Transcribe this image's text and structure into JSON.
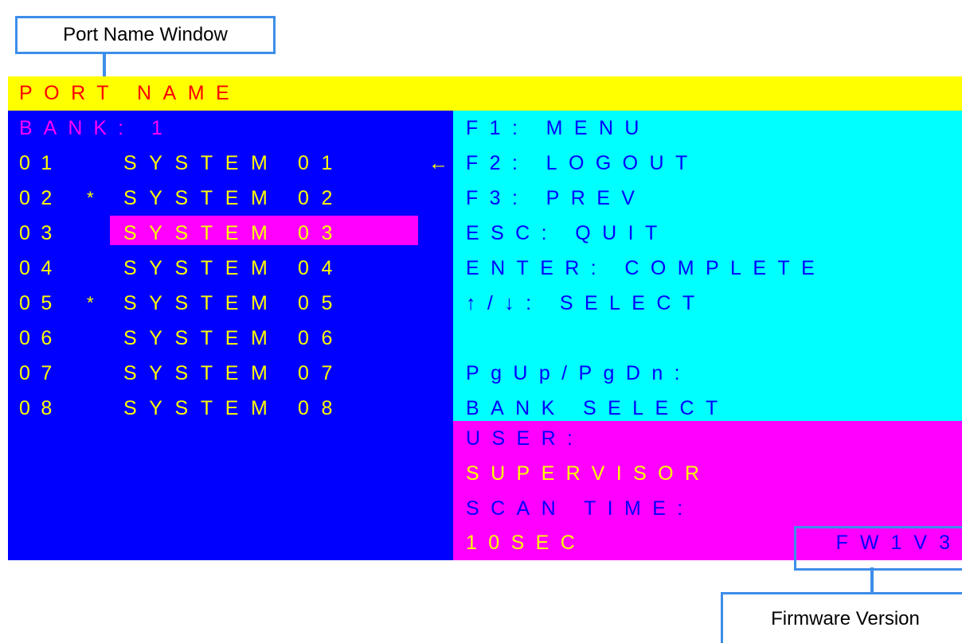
{
  "callouts": {
    "port_name_window": "Port Name Window",
    "firmware_version": "Firmware Version"
  },
  "osd": {
    "title": "PORT NAME",
    "bank_label": "BANK: 1",
    "ports": [
      {
        "number": "01",
        "star": "",
        "name": "SYSTEM 01",
        "selected": false,
        "arrow": "←"
      },
      {
        "number": "02",
        "star": "*",
        "name": "SYSTEM 02",
        "selected": false,
        "arrow": ""
      },
      {
        "number": "03",
        "star": "",
        "name": "SYSTEM 03",
        "selected": true,
        "arrow": ""
      },
      {
        "number": "04",
        "star": "",
        "name": "SYSTEM 04",
        "selected": false,
        "arrow": ""
      },
      {
        "number": "05",
        "star": "*",
        "name": "SYSTEM 05",
        "selected": false,
        "arrow": ""
      },
      {
        "number": "06",
        "star": "",
        "name": "SYSTEM 06",
        "selected": false,
        "arrow": ""
      },
      {
        "number": "07",
        "star": "",
        "name": "SYSTEM 07",
        "selected": false,
        "arrow": ""
      },
      {
        "number": "08",
        "star": "",
        "name": "SYSTEM 08",
        "selected": false,
        "arrow": ""
      }
    ],
    "hotkeys": [
      "F1: MENU",
      "F2: LOGOUT",
      "F3: PREV",
      "ESC: QUIT",
      "ENTER: COMPLETE",
      "↑/↓: SELECT",
      "",
      "PgUp/PgDn:",
      "BANK SELECT"
    ],
    "user_label": "USER:",
    "user_value": "SUPERVISOR",
    "scan_label": "SCAN TIME:",
    "scan_value": "10SEC",
    "firmware": "FW1V3"
  },
  "colors": {
    "title_bg": "#ffff00",
    "list_bg": "#0000ff",
    "hotkey_bg": "#00ffff",
    "status_bg": "#ff00ff",
    "callout_border": "#3d8ee8"
  }
}
